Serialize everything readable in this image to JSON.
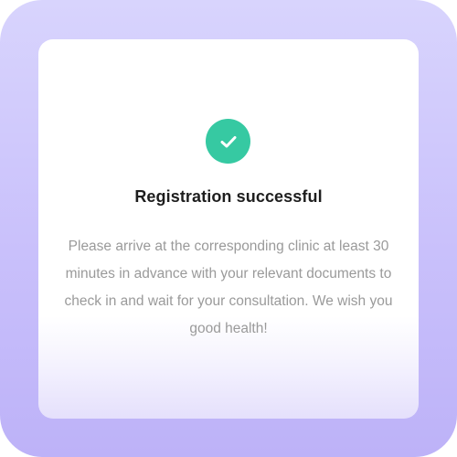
{
  "dialog": {
    "icon": "check-circle-icon",
    "accent_color": "#36c9a2",
    "title": "Registration successful",
    "message": "Please arrive at the corresponding clinic at least 30 minutes in advance with your relevant documents to check in and wait for your consultation. We wish you good health!"
  }
}
